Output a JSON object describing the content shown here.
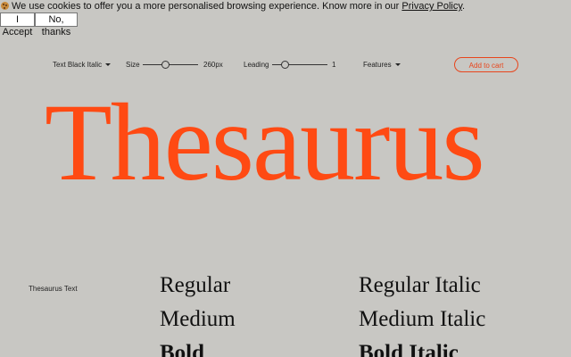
{
  "cookie_banner": {
    "message": "We use cookies to offer you a more personalised browsing experience. Know more in our ",
    "link_text": "Privacy Policy",
    "message_end": ".",
    "accept_label": "I Accept",
    "decline_label": "No, thanks"
  },
  "toolbar": {
    "style_select": "Text Black Italic",
    "size_label": "Size",
    "size_value": "260px",
    "leading_label": "Leading",
    "leading_value": "1",
    "features_label": "Features",
    "cart_label": "Add to cart"
  },
  "hero": {
    "text": "Thesaurus",
    "color": "#ff4a13"
  },
  "family": {
    "name": "Thesaurus Text",
    "styles_left": [
      "Regular",
      "Medium",
      "Bold"
    ],
    "styles_right": [
      "Regular Italic",
      "Medium Italic",
      "Bold Italic"
    ]
  },
  "icons": [
    "cookie-icon",
    "chevron-down-icon"
  ],
  "colors": {
    "accent": "#e8451c",
    "background": "#c8c7c3"
  }
}
